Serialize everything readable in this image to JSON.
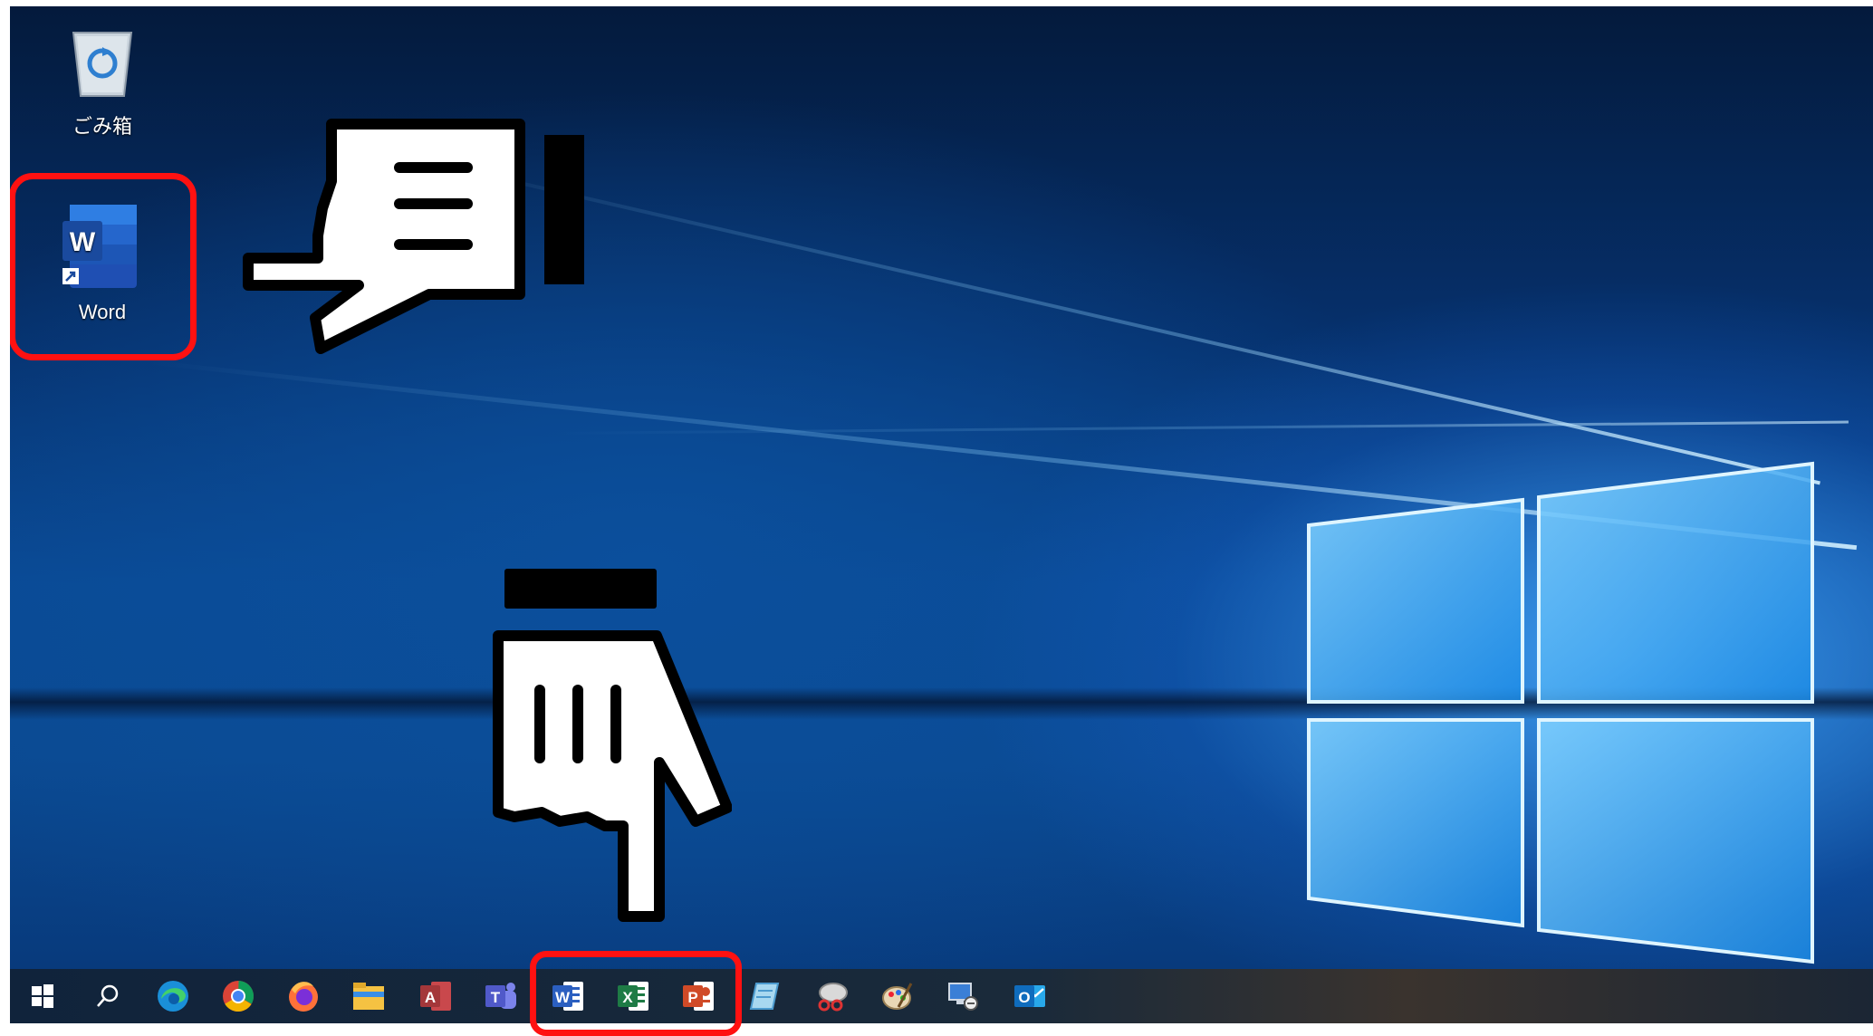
{
  "desktop": {
    "icons": [
      {
        "name": "recycle-bin",
        "label": "ごみ箱"
      },
      {
        "name": "word-shortcut",
        "label": "Word"
      }
    ]
  },
  "taskbar": {
    "items": [
      {
        "name": "start-icon"
      },
      {
        "name": "search-icon"
      },
      {
        "name": "edge-icon"
      },
      {
        "name": "chrome-icon"
      },
      {
        "name": "firefox-icon"
      },
      {
        "name": "file-explorer-icon"
      },
      {
        "name": "access-icon",
        "letter": "A"
      },
      {
        "name": "teams-icon",
        "letter": "T"
      },
      {
        "name": "word-icon",
        "letter": "W"
      },
      {
        "name": "excel-icon",
        "letter": "X"
      },
      {
        "name": "powerpoint-icon",
        "letter": "P"
      },
      {
        "name": "notepad-icon"
      },
      {
        "name": "snipping-tool-icon"
      },
      {
        "name": "paint-icon"
      },
      {
        "name": "remote-desktop-icon"
      },
      {
        "name": "outlook-icon",
        "letter": "O"
      }
    ]
  },
  "colors": {
    "highlight": "#ff1111",
    "word": "#2b5fc0",
    "excel": "#1e7b45",
    "powerpoint": "#d04a27",
    "access": "#a4373a",
    "teams": "#5059c9",
    "outlook": "#0f6cbd"
  }
}
